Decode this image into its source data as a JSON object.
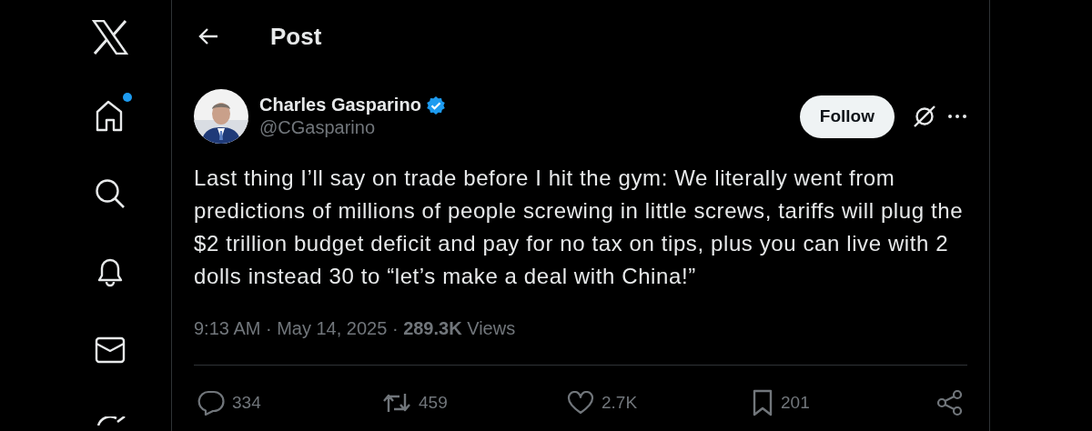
{
  "sidebar": {
    "items": [
      {
        "kind": "logo"
      },
      {
        "kind": "home",
        "badge": true
      },
      {
        "kind": "search"
      },
      {
        "kind": "notifications"
      },
      {
        "kind": "messages"
      },
      {
        "kind": "grok"
      }
    ]
  },
  "header": {
    "title": "Post"
  },
  "post": {
    "author": {
      "name": "Charles Gasparino",
      "handle": "@CGasparino",
      "verified": true
    },
    "follow_button": "Follow",
    "text": "Last thing I’ll say on trade before I hit the gym: We literally went from predictions of millions of people screwing in little screws, tariffs will plug the $2 trillion budget deficit and pay for no tax on tips, plus you can live with 2 dolls instead 30 to “let’s make a deal with China!”",
    "meta": "9:13 AM · May 14, 2025 · **289.3K** Views",
    "actions": [
      {
        "kind": "reply",
        "count": "334"
      },
      {
        "kind": "repost",
        "count": "459"
      },
      {
        "kind": "like",
        "count": "2.7K"
      },
      {
        "kind": "bookmark",
        "count": "201"
      },
      {
        "kind": "share"
      }
    ]
  }
}
